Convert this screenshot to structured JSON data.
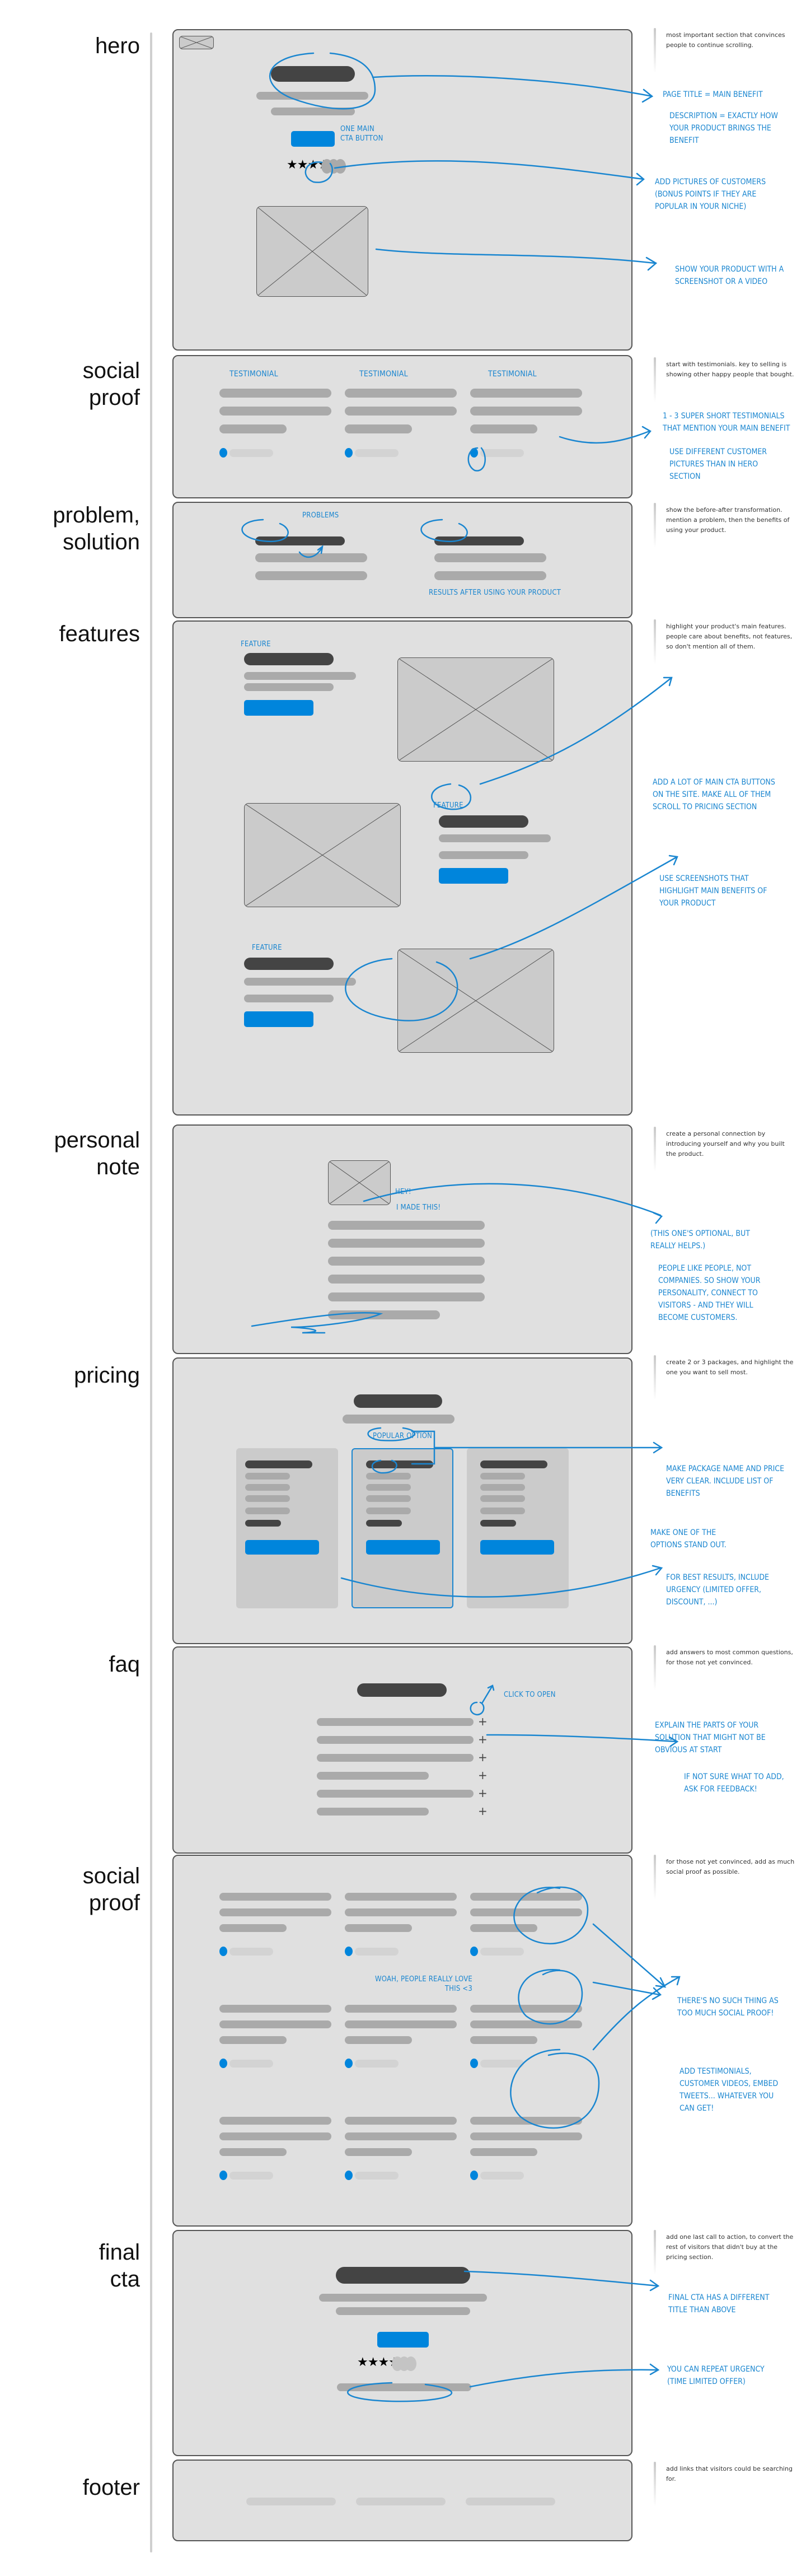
{
  "sections": [
    {
      "id": "hero",
      "label": "hero",
      "note": "most important section that convinces people to continue scrolling.",
      "annotations": [
        "page title = main benefit",
        "description = exactly how your product brings the benefit",
        "add pictures of customers (bonus points if they are popular in your niche)",
        "show your product with a screenshot or a video"
      ],
      "inline": [
        "one main cta button"
      ],
      "rating_stars": "★★★★★"
    },
    {
      "id": "social-proof",
      "label": "social\nproof",
      "note": "start with testimonials. key to selling is showing other happy people that bought.",
      "annotations": [
        "1 - 3 super short testimonials that mention your main benefit",
        "use different customer pictures than in hero section"
      ],
      "inline": [
        "testimonial",
        "testimonial",
        "testimonial"
      ]
    },
    {
      "id": "problem-solution",
      "label": "problem,\nsolution",
      "note": "show the before-after transformation. mention a problem, then the benefits of using your product.",
      "inline": [
        "problems",
        "results after using your product"
      ]
    },
    {
      "id": "features",
      "label": "features",
      "note": "highlight your product's main features. people care about benefits, not features, so don't mention all of them.",
      "annotations": [
        "add a lot of main cta buttons on the site. make all of them scroll to pricing section",
        "use screenshots that highlight main benefits of your product"
      ],
      "inline": [
        "feature",
        "feature",
        "feature"
      ]
    },
    {
      "id": "personal-note",
      "label": "personal\nnote",
      "note": "create a personal connection by introducing yourself and why you built the product.",
      "annotations": [
        "(this one's optional, but really helps.)",
        "people like people, not companies. so show your personality, connect to visitors - and they will become customers."
      ],
      "inline": [
        "hey!",
        "i made this!"
      ]
    },
    {
      "id": "pricing",
      "label": "pricing",
      "note": "create 2 or 3 packages, and highlight the one you want to sell most.",
      "annotations": [
        "make package name and price very clear. include list of benefits",
        "make one of the options stand out.",
        "for best results, include urgency (limited offer, discount, ...)"
      ],
      "inline": [
        "popular option"
      ]
    },
    {
      "id": "faq",
      "label": "faq",
      "note": "add answers to most common questions, for those not yet convinced.",
      "annotations": [
        "explain the parts of your solution that might not be obvious at start",
        "if not sure what to add, ask for feedback!"
      ],
      "inline": [
        "click to open"
      ],
      "toggle_symbol": "+"
    },
    {
      "id": "social-proof-2",
      "label": "social\nproof",
      "note": "for those not yet convinced, add as much social proof as possible.",
      "annotations": [
        "there's no such thing as too much social proof!",
        "add testimonials, customer videos, embed tweets... whatever you can get!"
      ],
      "inline": [
        "woah, people really love this <3"
      ]
    },
    {
      "id": "final-cta",
      "label": "final\ncta",
      "note": "add one last call to action, to convert the rest of visitors that didn't buy at the pricing section.",
      "annotations": [
        "final cta has a different title than above",
        "you can repeat urgency (time limited offer)"
      ],
      "rating_stars": "★★★★★"
    },
    {
      "id": "footer",
      "label": "footer",
      "note": "add links that visitors could be searching for."
    }
  ],
  "colors": {
    "accent": "#1a86d0",
    "cta": "#0085dc",
    "frame": "#e0e0e0",
    "dark_bar": "#444444",
    "mid_bar": "#aaaaaa"
  }
}
